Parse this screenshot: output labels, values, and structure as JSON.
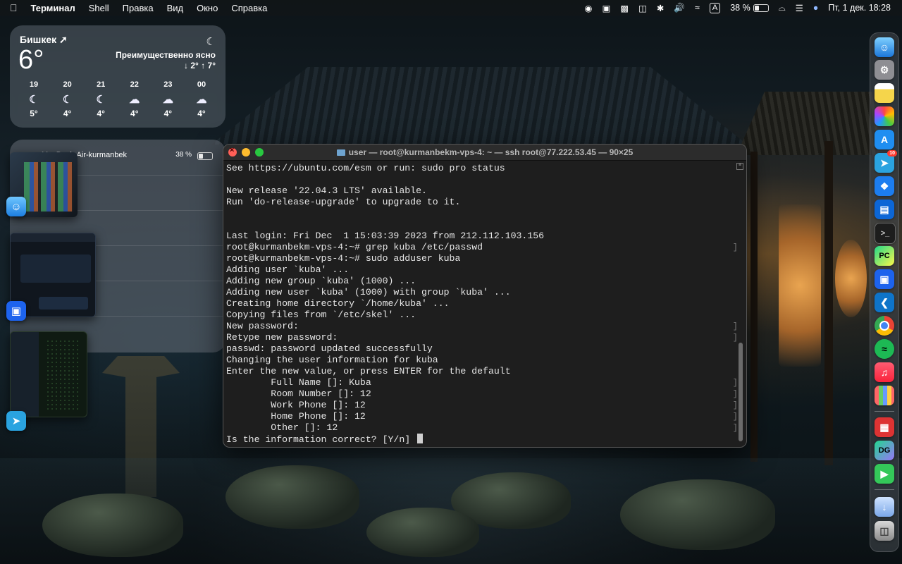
{
  "menubar": {
    "app_name": "Терминал",
    "menus": [
      "Shell",
      "Правка",
      "Вид",
      "Окно",
      "Справка"
    ],
    "battery_percent": "38 %",
    "input_source": "A",
    "date_time": "Пт, 1 дек.  18:28"
  },
  "weather": {
    "city": "Бишкек",
    "temperature": "6°",
    "condition": "Преимущественно ясно",
    "low_high": "↓ 2° ↑ 7°",
    "hours": [
      {
        "time": "19",
        "icon": "moon-icon",
        "temp": "5°"
      },
      {
        "time": "20",
        "icon": "moon-icon",
        "temp": "4°"
      },
      {
        "time": "21",
        "icon": "moon-icon",
        "temp": "4°"
      },
      {
        "time": "22",
        "icon": "cloud-moon-icon",
        "temp": "4°"
      },
      {
        "time": "23",
        "icon": "cloud-icon",
        "temp": "4°"
      },
      {
        "time": "00",
        "icon": "cloud-moon-icon",
        "temp": "4°"
      }
    ]
  },
  "batteries": {
    "device_name": "MacBook-Air-kurmanbek",
    "percent": "38 %"
  },
  "terminal": {
    "title": "user — root@kurmanbekm-vps-4: ~ — ssh root@77.222.53.45 — 90×25",
    "lines": [
      "See https://ubuntu.com/esm or run: sudo pro status",
      "",
      "New release '22.04.3 LTS' available.",
      "Run 'do-release-upgrade' to upgrade to it.",
      "",
      "",
      "Last login: Fri Dec  1 15:03:39 2023 from 212.112.103.156",
      "root@kurmanbekm-vps-4:~# grep kuba /etc/passwd",
      "root@kurmanbekm-vps-4:~# sudo adduser kuba",
      "Adding user `kuba' ...",
      "Adding new group `kuba' (1000) ...",
      "Adding new user `kuba' (1000) with group `kuba' ...",
      "Creating home directory `/home/kuba' ...",
      "Copying files from `/etc/skel' ...",
      "New password:",
      "Retype new password:",
      "passwd: password updated successfully",
      "Changing the user information for kuba",
      "Enter the new value, or press ENTER for the default",
      "        Full Name []: Kuba",
      "        Room Number []: 12",
      "        Work Phone []: 12",
      "        Home Phone []: 12",
      "        Other []: 12",
      "Is the information correct? [Y/n] "
    ]
  },
  "dock": {
    "telegram_badge": "10",
    "items": [
      "finder-icon",
      "system-settings-icon",
      "notes-icon",
      "photos-icon",
      "app-store-icon",
      "telegram-icon",
      "safari-icon",
      "trello-icon",
      "terminal-icon",
      "pycharm-icon",
      "docker-icon",
      "vscode-icon",
      "chrome-icon",
      "spotify-icon",
      "music-icon",
      "launchpad-icon",
      "preview-icon",
      "datagrip-icon",
      "facetime-icon",
      "downloads-icon",
      "trash-icon"
    ],
    "pycharm_label": "PC",
    "datagrip_label": "DG"
  }
}
